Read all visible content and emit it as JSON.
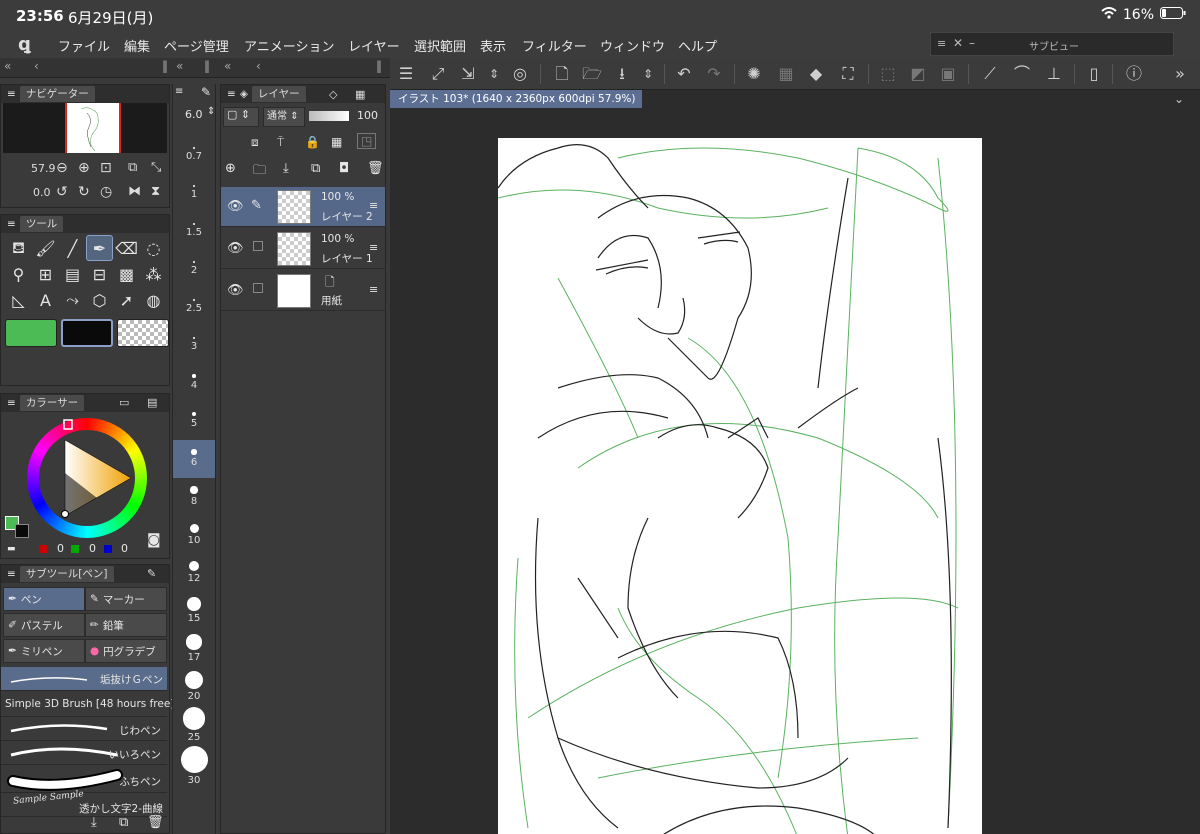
{
  "status": {
    "time": "23:56",
    "date": "6月29日(月)",
    "battery": "16%"
  },
  "menu": [
    "ファイル",
    "編集",
    "ページ管理",
    "アニメーション",
    "レイヤー",
    "選択範囲",
    "表示",
    "フィルター",
    "ウィンドウ",
    "ヘルプ"
  ],
  "subview": {
    "title": "サブビュー"
  },
  "navigator": {
    "tab": "ナビゲーター",
    "zoom": "57.9",
    "angle": "0.0"
  },
  "tool_panel": {
    "tab": "ツール"
  },
  "color_panel": {
    "tab": "カラーサー",
    "r": "0",
    "g": "0",
    "b": "0",
    "main_color": "#4cbb55",
    "sub_color": "#0a0a0a"
  },
  "subtool_panel": {
    "tab": "サブツール[ペン]",
    "buttons": [
      "ペン",
      "マーカー",
      "パステル",
      "鉛筆",
      "ミリペン",
      "円グラデブ"
    ],
    "brushes": [
      "垢抜けＧペン",
      "Simple 3D Brush [48 hours free]",
      "じわペン",
      "いいろペン",
      "ふちペン",
      "透かし文字2-曲線"
    ],
    "sample_text": "Sample Sample"
  },
  "brush_size": {
    "current": "6.0",
    "sizes": [
      "0.7",
      "1",
      "1.5",
      "2",
      "2.5",
      "3",
      "4",
      "5",
      "6",
      "8",
      "10",
      "12",
      "15",
      "17",
      "20",
      "25",
      "30"
    ],
    "active": "6"
  },
  "layer_panel": {
    "tab": "レイヤー",
    "blend": "通常",
    "opacity": "100",
    "layers": [
      {
        "opacity": "100 %",
        "name": "レイヤー 2",
        "active": true
      },
      {
        "opacity": "100 %",
        "name": "レイヤー 1",
        "active": false
      },
      {
        "opacity": "",
        "name": "用紙",
        "active": false
      }
    ]
  },
  "document": {
    "tab": "イラスト 103* (1640 x 2360px 600dpi 57.9%)"
  }
}
